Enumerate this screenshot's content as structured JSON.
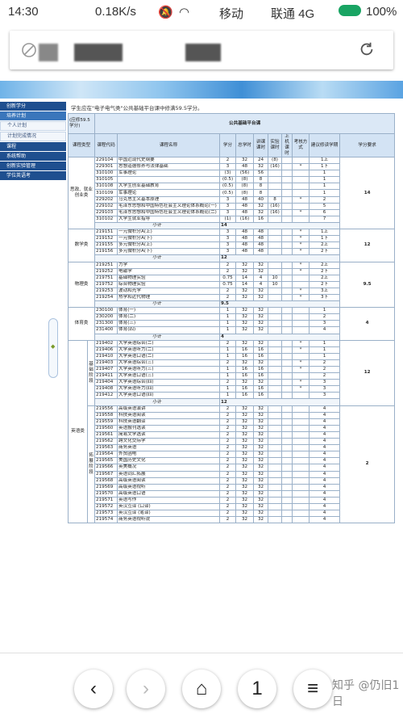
{
  "statusbar": {
    "time": "14:30",
    "speed": "0.18K/s",
    "carrier1": "移动",
    "carrier2": "联通 4G",
    "battery": "100%"
  },
  "nav": [
    {
      "label": "创新学分",
      "type": "main"
    },
    {
      "label": "培养计划",
      "type": "hl"
    },
    {
      "label": "个人计划",
      "type": "sub"
    },
    {
      "label": "计划完成情况",
      "type": "sub"
    },
    {
      "label": "课程",
      "type": "main"
    },
    {
      "label": "系统帮助",
      "type": "main"
    },
    {
      "label": "创新实验管理",
      "type": "main"
    },
    {
      "label": "学位英语考",
      "type": "main"
    }
  ],
  "intro": "学生应在\"电子电气类\"公共基础平台课中修满59.5学分。",
  "table": {
    "corner": "(应修59.5学分)",
    "platform": "公共基础平台课",
    "headers": [
      "课程类型",
      "课程代码",
      "课程名称",
      "学分",
      "总学时",
      "讲课课时",
      "实验课时",
      "上机课时",
      "考核方式",
      "建议修读学期",
      "学分要求"
    ],
    "groups": [
      {
        "type": "思政、就业创业类",
        "req": "14",
        "rows": [
          [
            "229104",
            "中国近现代史纲要",
            "2",
            "32",
            "24",
            "(8)",
            "",
            "",
            "1上"
          ],
          [
            "229301",
            "思想道德修养与法律基础",
            "3",
            "48",
            "32",
            "(16)",
            "",
            "*",
            "1下"
          ],
          [
            "310100",
            "军事理论",
            "(3)",
            "(56)",
            "56",
            "",
            "",
            "",
            "1"
          ],
          [
            "310105",
            "",
            "(0.5)",
            "(8)",
            "8",
            "",
            "",
            "",
            "1"
          ],
          [
            "310108",
            "大学生创业基础教育",
            "(0.5)",
            "(8)",
            "8",
            "",
            "",
            "",
            "1"
          ],
          [
            "310109",
            "军事理论",
            "(0.5)",
            "(8)",
            "8",
            "",
            "",
            "",
            "1"
          ],
          [
            "229202",
            "马克思主义基本原理",
            "3",
            "48",
            "40",
            "8",
            "",
            "*",
            "2"
          ],
          [
            "229102",
            "毛泽东思想和中国特色社会主义理论体系概论(一)",
            "3",
            "48",
            "32",
            "(16)",
            "",
            "",
            "5"
          ],
          [
            "229103",
            "毛泽东思想和中国特色社会主义理论体系概论(二)",
            "3",
            "48",
            "32",
            "(16)",
            "",
            "*",
            "6"
          ],
          [
            "310102",
            "大学生就业指导",
            "(1)",
            "(16)",
            "16",
            "",
            "",
            "",
            "7"
          ]
        ],
        "subtotal": "14"
      },
      {
        "type": "数学类",
        "req": "12",
        "rows": [
          [
            "219151",
            "一元微积分A(上)",
            "3",
            "48",
            "48",
            "",
            "",
            "*",
            "1上"
          ],
          [
            "219152",
            "一元微积分A(下)",
            "3",
            "48",
            "48",
            "",
            "",
            "*",
            "1下"
          ],
          [
            "219155",
            "多元微积分A(上)",
            "3",
            "48",
            "48",
            "",
            "",
            "*",
            "2上"
          ],
          [
            "219156",
            "多元微积分A(下)",
            "3",
            "48",
            "48",
            "",
            "",
            "*",
            "2下"
          ]
        ],
        "subtotal": "12"
      },
      {
        "type": "物理类",
        "req": "9.5",
        "rows": [
          [
            "219251",
            "力学",
            "2",
            "32",
            "32",
            "",
            "",
            "*",
            "2上"
          ],
          [
            "219252",
            "电磁学",
            "2",
            "32",
            "32",
            "",
            "",
            "*",
            "2下"
          ],
          [
            "219751",
            "基础物理实验",
            "0.75",
            "14",
            "4",
            "10",
            "",
            "",
            "2上"
          ],
          [
            "219752",
            "综合物理实验",
            "0.75",
            "14",
            "4",
            "10",
            "",
            "",
            "2下"
          ],
          [
            "219253",
            "波动和光学",
            "2",
            "32",
            "32",
            "",
            "",
            "*",
            "3上"
          ],
          [
            "219254",
            "热学和近代物理",
            "2",
            "32",
            "32",
            "",
            "",
            "*",
            "3下"
          ]
        ],
        "subtotal": "9.5"
      },
      {
        "type": "体育类",
        "req": "4",
        "rows": [
          [
            "230100",
            "体育(一)",
            "1",
            "32",
            "32",
            "",
            "",
            "",
            "1"
          ],
          [
            "230200",
            "体育(二)",
            "1",
            "32",
            "32",
            "",
            "",
            "",
            "2"
          ],
          [
            "231300",
            "体育(三)",
            "1",
            "32",
            "32",
            "",
            "",
            "",
            "3"
          ],
          [
            "231400",
            "体育(四)",
            "1",
            "32",
            "32",
            "",
            "",
            "",
            "4"
          ]
        ],
        "subtotal": "4"
      },
      {
        "type": "英语类",
        "sub": "基础阶段",
        "req": "12",
        "rows": [
          [
            "219402",
            "大学英语综合(二)",
            "2",
            "32",
            "32",
            "",
            "",
            "*",
            "1"
          ],
          [
            "219406",
            "大学英语听力(二)",
            "1",
            "16",
            "16",
            "",
            "",
            "*",
            "1"
          ],
          [
            "219410",
            "大学英语口语(二)",
            "1",
            "16",
            "16",
            "",
            "",
            "",
            "1"
          ],
          [
            "219403",
            "大学英语综合(三)",
            "2",
            "32",
            "32",
            "",
            "",
            "*",
            "2"
          ],
          [
            "219407",
            "大学英语听力(三)",
            "1",
            "16",
            "16",
            "",
            "",
            "*",
            "2"
          ],
          [
            "219411",
            "大学英语口语(三)",
            "1",
            "16",
            "16",
            "",
            "",
            "",
            "2"
          ],
          [
            "219404",
            "大学英语综合(四)",
            "2",
            "32",
            "32",
            "",
            "",
            "*",
            "3"
          ],
          [
            "219408",
            "大学英语听力(四)",
            "1",
            "16",
            "16",
            "",
            "",
            "*",
            "3"
          ],
          [
            "219412",
            "大学英语口语(四)",
            "1",
            "16",
            "16",
            "",
            "",
            "",
            "3"
          ]
        ],
        "subtotal": "12"
      },
      {
        "type": "",
        "sub": "拓展阶段",
        "req": "2",
        "rows": [
          [
            "219556",
            "高级英语演讲",
            "2",
            "32",
            "32",
            "",
            "",
            "",
            "4"
          ],
          [
            "219558",
            "科技英语阅读",
            "2",
            "32",
            "32",
            "",
            "",
            "",
            "4"
          ],
          [
            "219559",
            "科技英语翻译",
            "2",
            "32",
            "32",
            "",
            "",
            "",
            "4"
          ],
          [
            "219560",
            "英语报刊选读",
            "2",
            "32",
            "32",
            "",
            "",
            "",
            "4"
          ],
          [
            "219561",
            "简易文学选读",
            "2",
            "32",
            "32",
            "",
            "",
            "",
            "4"
          ],
          [
            "219562",
            "跨文化交际学",
            "2",
            "32",
            "32",
            "",
            "",
            "",
            "4"
          ],
          [
            "219563",
            "商务英语",
            "2",
            "32",
            "32",
            "",
            "",
            "",
            "4"
          ],
          [
            "219564",
            "外贸函电",
            "2",
            "32",
            "32",
            "",
            "",
            "",
            "4"
          ],
          [
            "219565",
            "美国历史文化",
            "2",
            "32",
            "32",
            "",
            "",
            "",
            "4"
          ],
          [
            "219566",
            "英美概况",
            "2",
            "32",
            "32",
            "",
            "",
            "",
            "4"
          ],
          [
            "219567",
            "英语词汇拓展",
            "2",
            "32",
            "32",
            "",
            "",
            "",
            "4"
          ],
          [
            "219568",
            "高级英语阅读",
            "2",
            "32",
            "32",
            "",
            "",
            "",
            "4"
          ],
          [
            "219569",
            "高级英语视听",
            "2",
            "32",
            "32",
            "",
            "",
            "",
            "4"
          ],
          [
            "219570",
            "高级英语口语",
            "2",
            "32",
            "32",
            "",
            "",
            "",
            "4"
          ],
          [
            "219571",
            "英语写作",
            "2",
            "32",
            "32",
            "",
            "",
            "",
            "4"
          ],
          [
            "219572",
            "英汉互译 (口译)",
            "2",
            "32",
            "32",
            "",
            "",
            "",
            "4"
          ],
          [
            "219573",
            "英汉互译 (笔译)",
            "2",
            "32",
            "32",
            "",
            "",
            "",
            "4"
          ],
          [
            "219574",
            "商务英语视听说",
            "2",
            "32",
            "32",
            "",
            "",
            "",
            "4"
          ]
        ]
      }
    ],
    "subtotal_label": "小计"
  },
  "bottombar": {
    "back": "‹",
    "forward": "›",
    "home": "⌂",
    "tabs": "1",
    "menu": "≡",
    "watermark": "知乎 @仍旧1日"
  }
}
